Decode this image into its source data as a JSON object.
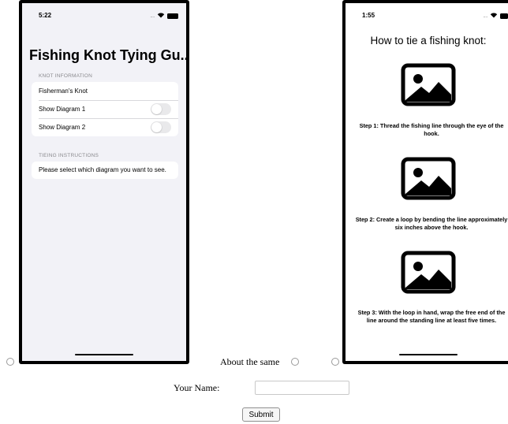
{
  "left_phone": {
    "status": {
      "time": "5:22",
      "dots": "....",
      "wifi_icon": "wifi-icon",
      "battery_icon": "battery-icon"
    },
    "title": "Fishing Knot Tying Gu...",
    "knot_section": {
      "header": "KNOT INFORMATION",
      "knot_name": "Fisherman's Knot",
      "toggles": [
        {
          "label": "Show Diagram 1",
          "on": false
        },
        {
          "label": "Show Diagram 2",
          "on": false
        }
      ]
    },
    "instructions_section": {
      "header": "TIEING INSTRUCTIONS",
      "text": "Please select which diagram you want to see."
    }
  },
  "right_phone": {
    "status": {
      "time": "1:55",
      "dots": "....",
      "wifi_icon": "wifi-icon",
      "battery_icon": "battery-icon"
    },
    "title": "How to tie a fishing knot:",
    "steps": [
      {
        "image_icon": "image-placeholder-icon",
        "text": "Step 1: Thread the fishing line through the eye of the hook."
      },
      {
        "image_icon": "image-placeholder-icon",
        "text": "Step 2: Create a loop by bending the line approximately six inches above the hook."
      },
      {
        "image_icon": "image-placeholder-icon",
        "text": "Step 3: With the loop in hand, wrap the free end of the line around the standing line at least five times."
      }
    ]
  },
  "form": {
    "comparison_label": "About the same",
    "name_label": "Your Name:",
    "name_value": "",
    "submit_label": "Submit"
  }
}
